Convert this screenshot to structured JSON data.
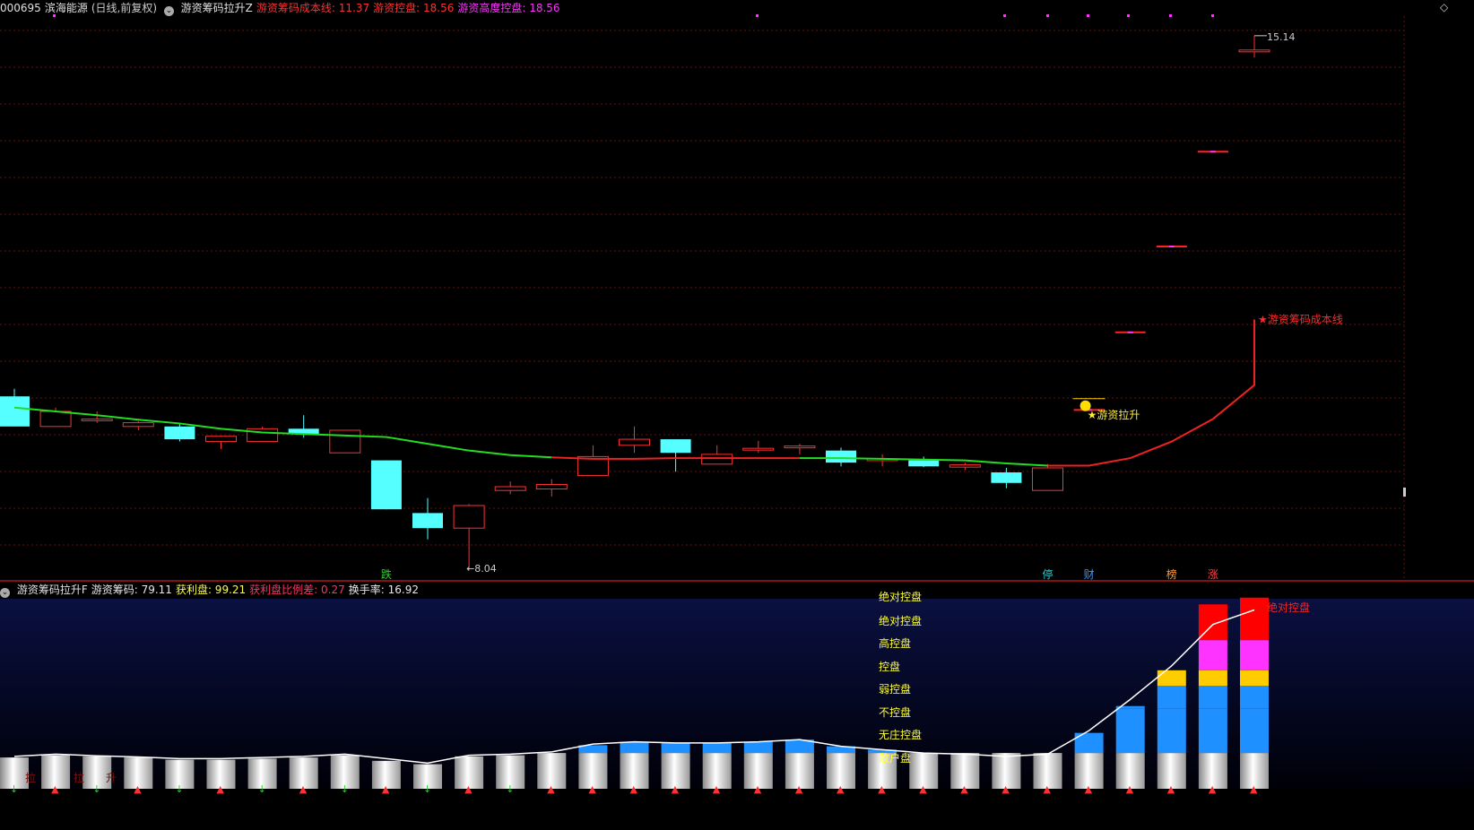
{
  "title_bar": {
    "code": "000695",
    "name": "滨海能源",
    "period": "(日线,前复权)",
    "indicator_icon": "settings-icon",
    "indicator_name": "游资筹码拉升Z",
    "items": [
      {
        "label": "游资筹码成本线:",
        "value": "11.37",
        "color": "#ff3030"
      },
      {
        "label": "游资控盘:",
        "value": "18.56",
        "color": "#ff3030"
      },
      {
        "label": "游资高度控盘:",
        "value": "18.56",
        "color": "#ff33ff"
      }
    ]
  },
  "sub_bar": {
    "indicator_icon": "settings-icon",
    "indicator_name": "游资筹码拉升F",
    "items": [
      {
        "label": "游资筹码:",
        "value": "79.11",
        "color": "#e8e8e8"
      },
      {
        "label": "获利盘:",
        "value": "99.21",
        "color": "#ffff33"
      },
      {
        "label": "获利盘比例差:",
        "value": "0.27",
        "color": "#ff3366"
      },
      {
        "label": "换手率:",
        "value": "16.92",
        "color": "#e8e8e8"
      }
    ]
  },
  "price_labels": {
    "high": "15.14",
    "low": "8.04"
  },
  "annotations": {
    "cost_line": "★游资筹码成本线",
    "pull_up": "★游资拉升",
    "smiley_icon": "smiley-icon"
  },
  "bottom_markers": [
    "跌",
    "停",
    "财",
    "榜",
    "涨"
  ],
  "levels": [
    "绝对控盘",
    "绝对控盘",
    "高控盘",
    "控盘",
    "弱控盘",
    "不控盘",
    "无庄控盘",
    "散户盘"
  ],
  "level_tag": "绝对控盘",
  "faded_marks": [
    "拉",
    "拉",
    "升"
  ],
  "chart_data": [
    {
      "type": "candlestick",
      "candles": [
        {
          "o": 10.35,
          "h": 10.45,
          "l": 9.95,
          "c": 9.95
        },
        {
          "o": 9.95,
          "h": 10.2,
          "l": 9.95,
          "c": 10.15
        },
        {
          "o": 10.05,
          "h": 10.15,
          "l": 10.0,
          "c": 10.05
        },
        {
          "o": 9.95,
          "h": 10.02,
          "l": 9.9,
          "c": 10.0
        },
        {
          "o": 9.95,
          "h": 10.0,
          "l": 9.75,
          "c": 9.78
        },
        {
          "o": 9.75,
          "h": 9.82,
          "l": 9.65,
          "c": 9.82
        },
        {
          "o": 9.75,
          "h": 9.95,
          "l": 9.75,
          "c": 9.92
        },
        {
          "o": 9.92,
          "h": 10.1,
          "l": 9.8,
          "c": 9.85
        },
        {
          "o": 9.6,
          "h": 9.9,
          "l": 9.6,
          "c": 9.9
        },
        {
          "o": 9.5,
          "h": 9.5,
          "l": 8.85,
          "c": 8.85
        },
        {
          "o": 8.8,
          "h": 9.0,
          "l": 8.45,
          "c": 8.6
        },
        {
          "o": 8.6,
          "h": 8.92,
          "l": 8.04,
          "c": 8.9
        },
        {
          "o": 9.1,
          "h": 9.22,
          "l": 9.05,
          "c": 9.15
        },
        {
          "o": 9.12,
          "h": 9.25,
          "l": 9.02,
          "c": 9.18
        },
        {
          "o": 9.3,
          "h": 9.7,
          "l": 9.3,
          "c": 9.55
        },
        {
          "o": 9.7,
          "h": 9.95,
          "l": 9.6,
          "c": 9.78
        },
        {
          "o": 9.78,
          "h": 9.78,
          "l": 9.35,
          "c": 9.6
        },
        {
          "o": 9.45,
          "h": 9.7,
          "l": 9.45,
          "c": 9.58
        },
        {
          "o": 9.64,
          "h": 9.76,
          "l": 9.6,
          "c": 9.66
        },
        {
          "o": 9.67,
          "h": 9.72,
          "l": 9.58,
          "c": 9.69
        },
        {
          "o": 9.63,
          "h": 9.67,
          "l": 9.42,
          "c": 9.47
        },
        {
          "o": 9.5,
          "h": 9.58,
          "l": 9.42,
          "c": 9.52
        },
        {
          "o": 9.5,
          "h": 9.55,
          "l": 9.41,
          "c": 9.42
        },
        {
          "o": 9.41,
          "h": 9.47,
          "l": 9.37,
          "c": 9.44
        },
        {
          "o": 9.34,
          "h": 9.4,
          "l": 9.13,
          "c": 9.2
        },
        {
          "o": 9.1,
          "h": 9.45,
          "l": 9.1,
          "c": 9.4
        },
        {
          "o": 10.17,
          "h": 10.17,
          "l": 10.17,
          "c": 10.17
        },
        {
          "o": 11.2,
          "h": 11.2,
          "l": 11.2,
          "c": 11.2
        },
        {
          "o": 12.34,
          "h": 12.34,
          "l": 12.34,
          "c": 12.34
        },
        {
          "o": 13.6,
          "h": 13.6,
          "l": 13.6,
          "c": 13.6
        },
        {
          "o": 14.95,
          "h": 15.14,
          "l": 14.85,
          "c": 14.95
        }
      ],
      "cost_line": [
        10.2,
        10.15,
        10.1,
        10.04,
        9.99,
        9.92,
        9.87,
        9.85,
        9.83,
        9.81,
        9.72,
        9.63,
        9.57,
        9.54,
        9.52,
        9.52,
        9.53,
        9.53,
        9.53,
        9.53,
        9.53,
        9.52,
        9.51,
        9.5,
        9.46,
        9.43,
        9.43,
        9.53,
        9.75,
        10.05,
        10.5,
        11.37
      ],
      "ylim": [
        7.9,
        15.4
      ]
    },
    {
      "type": "stacked-bar",
      "series": [
        {
          "name": "散户盘",
          "values": [
            28,
            30,
            29,
            28,
            26,
            26,
            27,
            28,
            30,
            25,
            22,
            29,
            30,
            32,
            32,
            32,
            32,
            32,
            32,
            32,
            32,
            32,
            32,
            32,
            32,
            32,
            32,
            32,
            32,
            32,
            32
          ]
        },
        {
          "name": "无庄控盘",
          "values": [
            0,
            0,
            0,
            0,
            0,
            0,
            0,
            0,
            0,
            0,
            0,
            0,
            0,
            0,
            7,
            10,
            9,
            9,
            10,
            12,
            6,
            3,
            0,
            0,
            0,
            0,
            18,
            40,
            40,
            40,
            40
          ]
        },
        {
          "name": "不控盘",
          "values": [
            0,
            0,
            0,
            0,
            0,
            0,
            0,
            0,
            0,
            0,
            0,
            0,
            0,
            0,
            0,
            0,
            0,
            0,
            0,
            0,
            0,
            0,
            0,
            0,
            0,
            0,
            0,
            2,
            20,
            20,
            20
          ]
        },
        {
          "name": "弱控盘",
          "values": [
            0,
            0,
            0,
            0,
            0,
            0,
            0,
            0,
            0,
            0,
            0,
            0,
            0,
            0,
            0,
            0,
            0,
            0,
            0,
            0,
            0,
            0,
            0,
            0,
            0,
            0,
            0,
            0,
            14,
            14,
            14
          ]
        },
        {
          "name": "高控盘",
          "values": [
            0,
            0,
            0,
            0,
            0,
            0,
            0,
            0,
            0,
            0,
            0,
            0,
            0,
            0,
            0,
            0,
            0,
            0,
            0,
            0,
            0,
            0,
            0,
            0,
            0,
            0,
            0,
            0,
            0,
            27,
            27
          ]
        },
        {
          "name": "绝对控盘",
          "values": [
            0,
            0,
            0,
            0,
            0,
            0,
            0,
            0,
            0,
            0,
            0,
            0,
            0,
            0,
            0,
            0,
            0,
            0,
            0,
            0,
            0,
            0,
            0,
            0,
            0,
            0,
            0,
            0,
            0,
            32,
            38
          ]
        }
      ],
      "series_colors": [
        "#ffffff",
        "#1e90ff",
        "#1e90ff",
        "#ffcc00",
        "#ff33ff",
        "#ff0000"
      ],
      "line": [
        29,
        31,
        29.5,
        28.5,
        27,
        27,
        28,
        29,
        31,
        27,
        23,
        30,
        31,
        33,
        40,
        42,
        41,
        41,
        42,
        44,
        38,
        35,
        32,
        31,
        29,
        31,
        52,
        80,
        110,
        147,
        160
      ],
      "ylim": [
        0,
        170
      ]
    }
  ]
}
